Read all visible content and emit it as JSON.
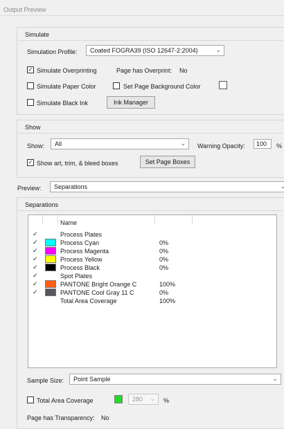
{
  "window": {
    "title": "Output Preview"
  },
  "simulate": {
    "header": "Simulate",
    "profile_label": "Simulation Profile:",
    "profile_value": "Coated FOGRA39 (ISO 12647-2:2004)",
    "overprinting_label": "Simulate Overprinting",
    "overprinting_checked": "✓",
    "page_overprint_label": "Page has Overprint:",
    "page_overprint_value": "No",
    "paper_color_label": "Simulate Paper Color",
    "page_bg_label": "Set Page Background Color",
    "black_ink_label": "Simulate Black Ink",
    "ink_manager_button": "Ink Manager"
  },
  "show": {
    "header": "Show",
    "show_label": "Show:",
    "show_value": "All",
    "warning_label": "Warning Opacity:",
    "warning_value": "100",
    "warning_unit": "%",
    "boxes_label": "Show art, trim, & bleed boxes",
    "boxes_checked": "✓",
    "page_boxes_button": "Set Page Boxes"
  },
  "preview": {
    "label": "Preview:",
    "value": "Separations"
  },
  "separations": {
    "header": "Separations",
    "column_name": "Name",
    "rows": [
      {
        "check": "✓",
        "swatch": "",
        "name": "Process Plates",
        "value": ""
      },
      {
        "check": "✓",
        "swatch": "#00ffff",
        "name": "Process Cyan",
        "value": "0%"
      },
      {
        "check": "✓",
        "swatch": "#ff00ff",
        "name": "Process Magenta",
        "value": "0%"
      },
      {
        "check": "✓",
        "swatch": "#ffff00",
        "name": "Process Yellow",
        "value": "0%"
      },
      {
        "check": "✓",
        "swatch": "#000000",
        "name": "Process Black",
        "value": "0%"
      },
      {
        "check": "✓",
        "swatch": "",
        "name": "Spot Plates",
        "value": ""
      },
      {
        "check": "✓",
        "swatch": "#ff5f15",
        "name": "PANTONE Bright Orange C",
        "value": "100%"
      },
      {
        "check": "✓",
        "swatch": "#54565a",
        "name": "PANTONE Cool Gray 11 C",
        "value": "0%"
      },
      {
        "check": "",
        "swatch": "",
        "name": "Total Area Coverage",
        "value": "100%"
      }
    ]
  },
  "sample": {
    "label": "Sample Size:",
    "value": "Point Sample"
  },
  "tac": {
    "label": "Total Area Coverage",
    "swatch_color": "#22dd22",
    "value": "280",
    "unit": "%"
  },
  "transparency": {
    "label": "Page has Transparency:",
    "value": "No"
  }
}
